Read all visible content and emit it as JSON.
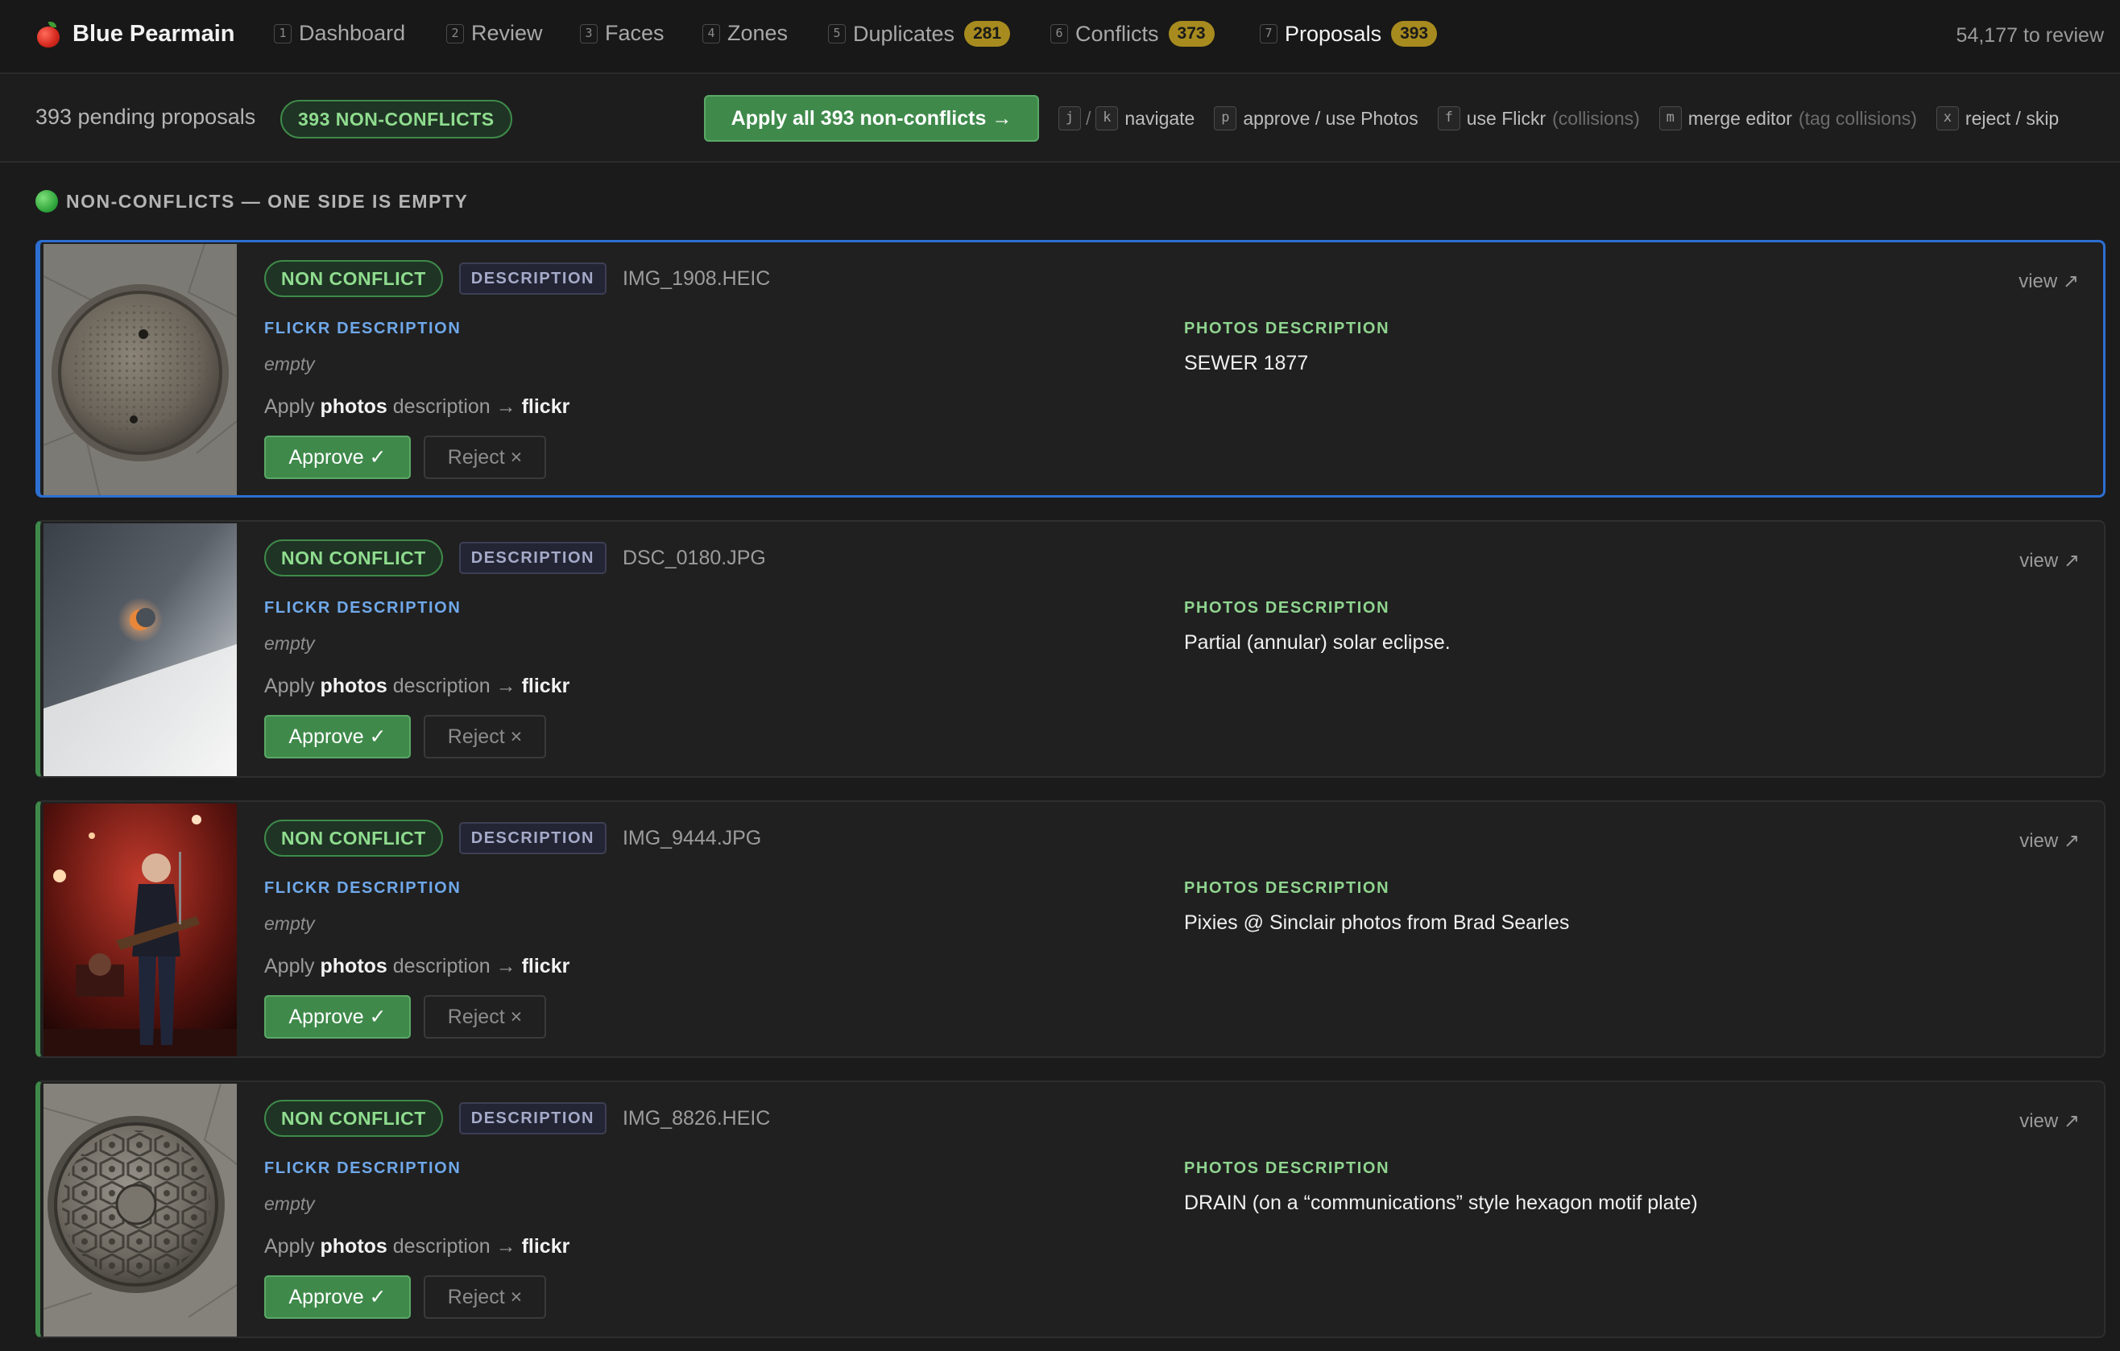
{
  "app": {
    "name": "Blue Pearmain",
    "logo_icon": "apple-icon"
  },
  "nav": {
    "items": [
      {
        "key": "1",
        "label": "Dashboard"
      },
      {
        "key": "2",
        "label": "Review"
      },
      {
        "key": "3",
        "label": "Faces"
      },
      {
        "key": "4",
        "label": "Zones"
      },
      {
        "key": "5",
        "label": "Duplicates",
        "count": "281"
      },
      {
        "key": "6",
        "label": "Conflicts",
        "count": "373"
      },
      {
        "key": "7",
        "label": "Proposals",
        "count": "393",
        "active": true
      }
    ],
    "to_review": "54,177 to review"
  },
  "toolbar": {
    "pending": "393 pending proposals",
    "nonconflicts_pill": "393 NON-CONFLICTS",
    "apply_all": "Apply all 393 non-conflicts →",
    "shortcuts": {
      "nav_key1": "j",
      "nav_sep": "/",
      "nav_key2": "k",
      "nav_label": "navigate",
      "p_key": "p",
      "p_label": "approve / use Photos",
      "f_key": "f",
      "f_label": "use Flickr",
      "f_note": "(collisions)",
      "m_key": "m",
      "m_label": "merge editor",
      "m_note": "(tag collisions)",
      "x_key": "x",
      "x_label": "reject / skip"
    }
  },
  "section": {
    "title": "NON-CONFLICTS — ONE SIDE IS EMPTY",
    "icon": "green-circle-icon"
  },
  "colors": {
    "accent_green": "#3f8a4b",
    "selected_blue": "#2d6fd1",
    "badge_gold": "#a78b1f",
    "flickr_blue": "#6fa8ea",
    "photos_green": "#8fd48f"
  },
  "cards": [
    {
      "status": "NON CONFLICT",
      "type": "DESCRIPTION",
      "filename": "IMG_1908.HEIC",
      "view": "view ↗",
      "flickr_label": "FLICKR DESCRIPTION",
      "flickr_value": "empty",
      "photos_label": "PHOTOS DESCRIPTION",
      "photos_value": "SEWER 1877",
      "apply_prefix": "Apply",
      "apply_source": "photos",
      "apply_mid": "description →",
      "apply_target": "flickr",
      "approve": "Approve ✓",
      "reject": "Reject ×",
      "selected": true
    },
    {
      "status": "NON CONFLICT",
      "type": "DESCRIPTION",
      "filename": "DSC_0180.JPG",
      "view": "view ↗",
      "flickr_label": "FLICKR DESCRIPTION",
      "flickr_value": "empty",
      "photos_label": "PHOTOS DESCRIPTION",
      "photos_value": "Partial (annular) solar eclipse.",
      "apply_prefix": "Apply",
      "apply_source": "photos",
      "apply_mid": "description →",
      "apply_target": "flickr",
      "approve": "Approve ✓",
      "reject": "Reject ×"
    },
    {
      "status": "NON CONFLICT",
      "type": "DESCRIPTION",
      "filename": "IMG_9444.JPG",
      "view": "view ↗",
      "flickr_label": "FLICKR DESCRIPTION",
      "flickr_value": "empty",
      "photos_label": "PHOTOS DESCRIPTION",
      "photos_value": "Pixies @ Sinclair photos from Brad Searles",
      "apply_prefix": "Apply",
      "apply_source": "photos",
      "apply_mid": "description →",
      "apply_target": "flickr",
      "approve": "Approve ✓",
      "reject": "Reject ×"
    },
    {
      "status": "NON CONFLICT",
      "type": "DESCRIPTION",
      "filename": "IMG_8826.HEIC",
      "view": "view ↗",
      "flickr_label": "FLICKR DESCRIPTION",
      "flickr_value": "empty",
      "photos_label": "PHOTOS DESCRIPTION",
      "photos_value": "DRAIN (on a “communications” style hexagon motif plate)",
      "apply_prefix": "Apply",
      "apply_source": "photos",
      "apply_mid": "description →",
      "apply_target": "flickr",
      "approve": "Approve ✓",
      "reject": "Reject ×"
    }
  ]
}
